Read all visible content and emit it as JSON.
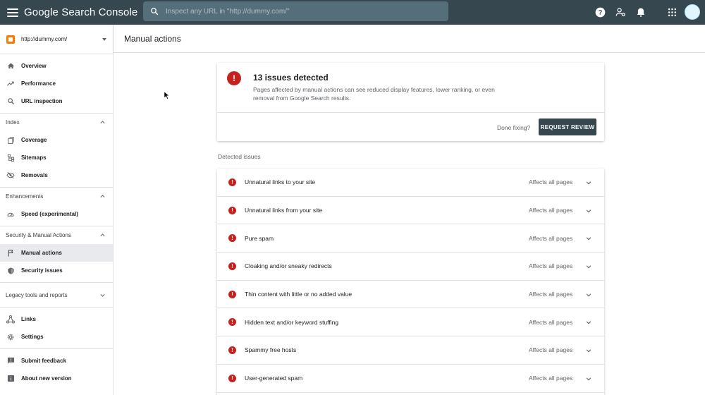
{
  "app": {
    "brand": "Google Search Console",
    "search_placeholder": "Inspect any URL in \"http://dummy.com/\""
  },
  "topbar_icons": [
    "help-icon",
    "manage-users-icon",
    "notifications-icon",
    "apps-grid-icon",
    "account-avatar"
  ],
  "sidebar": {
    "property": "http://dummy.com/",
    "top_items": [
      {
        "label": "Overview",
        "icon": "home-icon"
      },
      {
        "label": "Performance",
        "icon": "trending-icon"
      },
      {
        "label": "URL inspection",
        "icon": "search-icon"
      }
    ],
    "sections": [
      {
        "title": "Index",
        "expanded": true,
        "items": [
          {
            "label": "Coverage",
            "icon": "coverage-icon"
          },
          {
            "label": "Sitemaps",
            "icon": "sitemap-icon"
          },
          {
            "label": "Removals",
            "icon": "removals-icon"
          }
        ]
      },
      {
        "title": "Enhancements",
        "expanded": true,
        "items": [
          {
            "label": "Speed (experimental)",
            "icon": "speed-icon"
          }
        ]
      },
      {
        "title": "Security & Manual Actions",
        "expanded": true,
        "items": [
          {
            "label": "Manual actions",
            "icon": "flag-icon",
            "active": true
          },
          {
            "label": "Security issues",
            "icon": "shield-icon"
          }
        ]
      },
      {
        "title": "Legacy tools and reports",
        "expanded": false,
        "items": []
      }
    ],
    "bottom_items": [
      {
        "label": "Links",
        "icon": "links-icon"
      },
      {
        "label": "Settings",
        "icon": "settings-icon"
      }
    ],
    "footer_items": [
      {
        "label": "Submit feedback",
        "icon": "feedback-icon"
      },
      {
        "label": "About new version",
        "icon": "info-icon"
      }
    ]
  },
  "header": {
    "title": "Manual actions"
  },
  "summary": {
    "title": "13 issues detected",
    "description": "Pages affected by manual actions can see reduced display features, lower ranking, or even removal from Google Search results.",
    "done_fixing": "Done fixing?",
    "request_review": "REQUEST REVIEW"
  },
  "issues": {
    "heading": "Detected issues",
    "rows": [
      {
        "name": "Unnatural links to your site",
        "scope": "Affects all pages"
      },
      {
        "name": "Unnatural links from your site",
        "scope": "Affects all pages"
      },
      {
        "name": "Pure spam",
        "scope": "Affects all pages"
      },
      {
        "name": "Cloaking and/or sneaky redirects",
        "scope": "Affects all pages"
      },
      {
        "name": "Thin content with little or no added value",
        "scope": "Affects all pages"
      },
      {
        "name": "Hidden text and/or keyword stuffing",
        "scope": "Affects all pages"
      },
      {
        "name": "Spammy free hosts",
        "scope": "Affects all pages"
      },
      {
        "name": "User-generated spam",
        "scope": "Affects all pages"
      }
    ]
  },
  "colors": {
    "topbar": "#37474f",
    "error": "#c5221f",
    "button": "#37474f"
  }
}
